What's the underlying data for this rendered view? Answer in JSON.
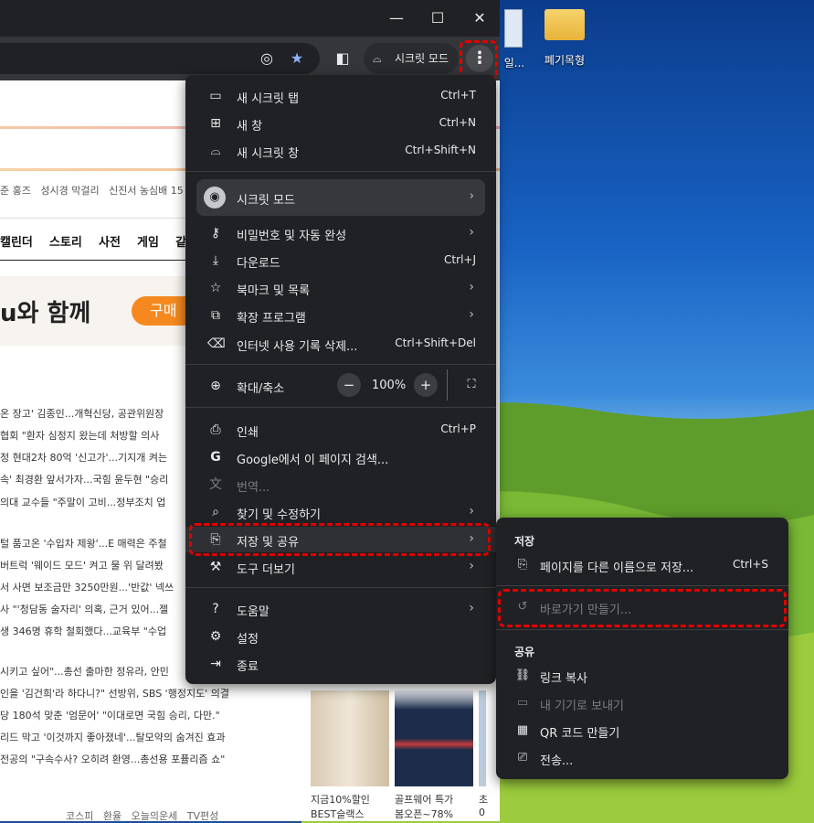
{
  "desktop": {
    "icons": [
      {
        "label": "일..."
      },
      {
        "label": "폐기목형"
      }
    ]
  },
  "browser": {
    "window_controls": {
      "minimize": "—",
      "maximize": "☐",
      "close": "✕"
    },
    "incognito_chip": "시크릿 모드",
    "kebab": "⋮"
  },
  "page": {
    "trending": [
      "준 홍즈",
      "성시경 막걸리",
      "신진서 농심배 15"
    ],
    "nav": [
      "캘린더",
      "스토리",
      "사전",
      "게임",
      "같이"
    ],
    "banner": {
      "text": "u와 함께",
      "button": "구매"
    },
    "headlines": [
      "온 장고' 김종인...개혁신당, 공관위원장",
      "협회 \"환자 심정지 왔는데 처방할 의사",
      "정 현대2차 80억 '신고가'...기지개 켜는",
      "속' 최경환 앞서가자...국힘 윤두현 \"승리",
      "의대 교수들 \"주말이 고비...정부조치 업",
      "털 품고온 '수입차 제왕'...E 매력은 주철",
      "버트럭 '웨이드 모드' 켜고 물 위 달려봤",
      "서 사면 보조금만 3250만원...'반값' 넥쓰",
      "사 \"'청담동 술자리' 의혹, 근거 있어...젤",
      "생 346명 휴학 철회했다...교육부 \"수업",
      "시키고 싶어\"...총선 출마한 정유라, 안민",
      "인을 '김건희'라 하다니?\" 선방위, SBS '행정지도' 의결",
      "당 180석 맞춘 '엄문어' \"이대로면 국힘 승리, 다만.\"",
      "리드 막고 '이것까지 좋아졌네'...탈모약의 숨겨진 효과",
      "전공의 \"구속수사? 오히려 환영...총선용 포퓰리즘 쇼\""
    ],
    "footer": [
      "코스피",
      "환율",
      "오늘의운세",
      "TV편성"
    ],
    "ads": [
      "지금10%할인",
      "BEST슬랙스",
      "골프웨어 특가",
      "봄오픈~78%",
      "초",
      "0"
    ]
  },
  "menu": {
    "items": [
      {
        "icon": "new-tab-icon",
        "glyph": "▭",
        "label": "새 시크릿 탭",
        "shortcut": "Ctrl+T"
      },
      {
        "icon": "new-window-icon",
        "glyph": "⊞",
        "label": "새 창",
        "shortcut": "Ctrl+N"
      },
      {
        "icon": "incognito-icon",
        "glyph": "⌓",
        "label": "새 시크릿 창",
        "shortcut": "Ctrl+Shift+N"
      },
      {
        "icon": "incognito-icon",
        "glyph": "◉",
        "label": "시크릿 모드",
        "arrow": "›"
      },
      {
        "icon": "key-icon",
        "glyph": "⚷",
        "label": "비밀번호 및 자동 완성",
        "arrow": "›"
      },
      {
        "icon": "download-icon",
        "glyph": "⤓",
        "label": "다운로드",
        "shortcut": "Ctrl+J"
      },
      {
        "icon": "star-icon",
        "glyph": "☆",
        "label": "북마크 및 목록",
        "arrow": "›"
      },
      {
        "icon": "extension-icon",
        "glyph": "⧉",
        "label": "확장 프로그램",
        "arrow": "›"
      },
      {
        "icon": "trash-icon",
        "glyph": "🗑",
        "label": "인터넷 사용 기록 삭제...",
        "shortcut": "Ctrl+Shift+Del"
      },
      {
        "icon": "zoom-icon",
        "glyph": "⊕",
        "label": "확대/축소"
      },
      {
        "icon": "print-icon",
        "glyph": "⎙",
        "label": "인쇄",
        "shortcut": "Ctrl+P"
      },
      {
        "icon": "google-icon",
        "glyph": "G",
        "label": "Google에서 이 페이지 검색..."
      },
      {
        "icon": "translate-icon",
        "glyph": "文",
        "label": "번역..."
      },
      {
        "icon": "find-icon",
        "glyph": "⌕",
        "label": "찾기 및 수정하기",
        "arrow": "›"
      },
      {
        "icon": "save-share-icon",
        "glyph": "⎘",
        "label": "저장 및 공유",
        "arrow": "›"
      },
      {
        "icon": "tools-icon",
        "glyph": "⚙",
        "label": "도구 더보기",
        "arrow": "›"
      },
      {
        "icon": "help-icon",
        "glyph": "?",
        "label": "도움말",
        "arrow": "›"
      },
      {
        "icon": "settings-icon",
        "glyph": "⚙",
        "label": "설정"
      },
      {
        "icon": "exit-icon",
        "glyph": "⇥",
        "label": "종료"
      }
    ],
    "zoom": {
      "minus": "−",
      "value": "100%",
      "plus": "+",
      "fullscreen": "⛶"
    }
  },
  "submenu": {
    "save_header": "저장",
    "share_header": "공유",
    "items": [
      {
        "glyph": "⎘",
        "label": "페이지를 다른 이름으로 저장...",
        "shortcut": "Ctrl+S"
      },
      {
        "glyph": "↺",
        "label": "바로가기 만들기..."
      },
      {
        "glyph": "⛓",
        "label": "링크 복사"
      },
      {
        "glyph": "▭",
        "label": "내 기기로 보내기"
      },
      {
        "glyph": "▦",
        "label": "QR 코드 만들기"
      },
      {
        "glyph": "⎚",
        "label": "전송..."
      }
    ]
  }
}
